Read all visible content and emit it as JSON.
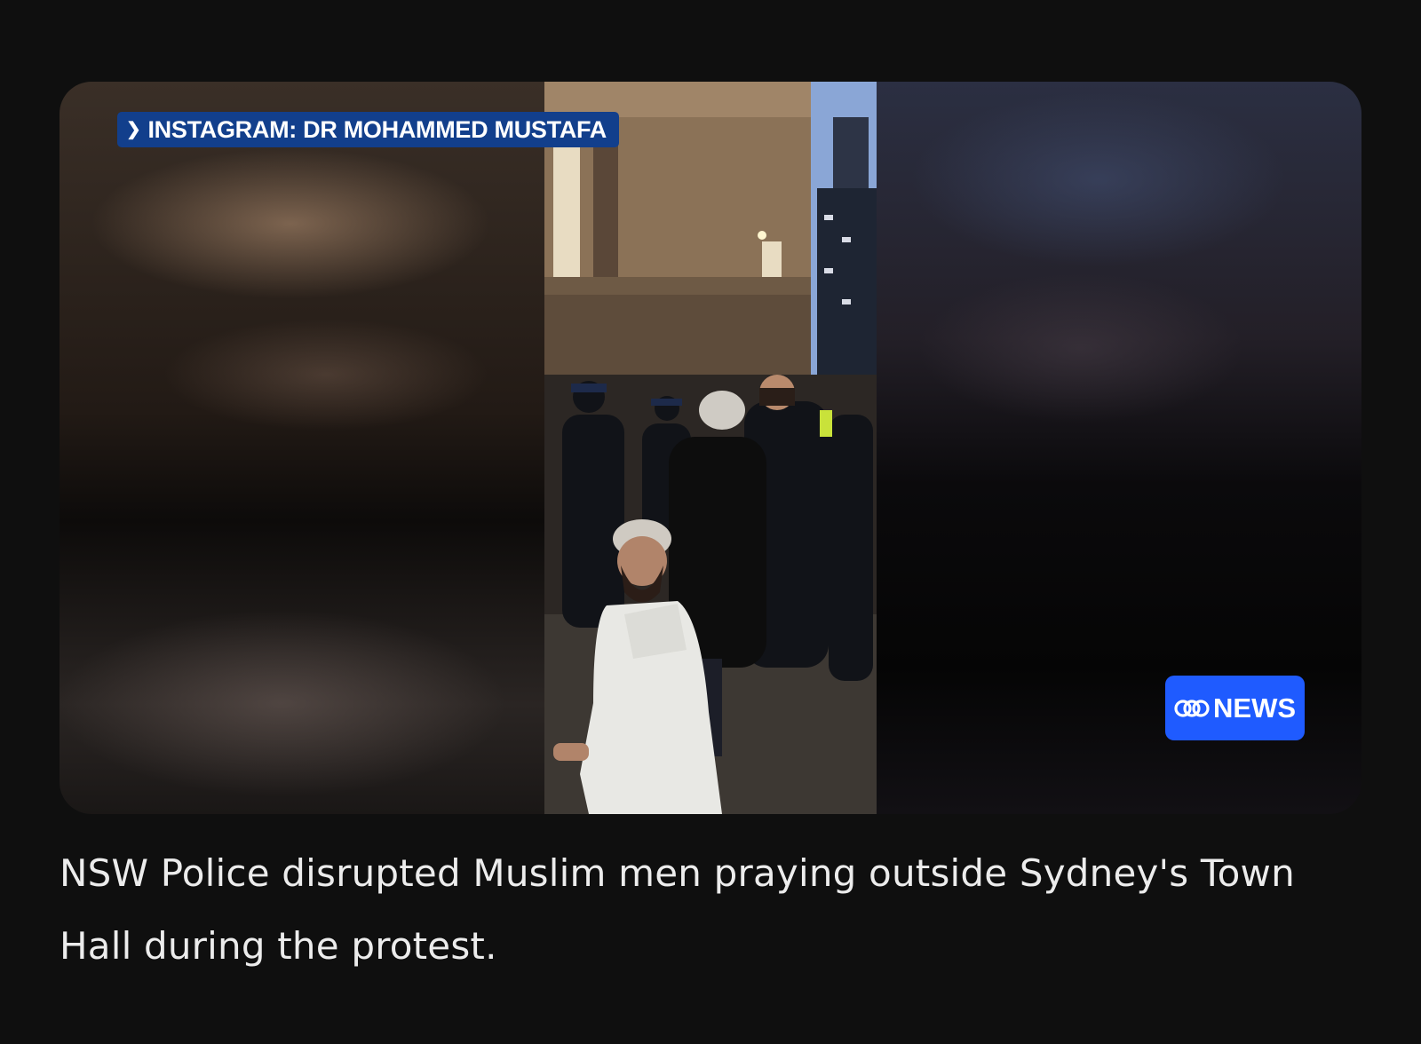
{
  "video": {
    "source_tag": "INSTAGRAM: DR MOHAMMED MUSTAFA",
    "source_icon": "play-chevron-icon",
    "brand_badge": "NEWS",
    "brand_icon": "abc-logo-icon",
    "scene": "police-prayer-photo"
  },
  "caption": "NSW Police disrupted Muslim men praying outside Sydney's Town Hall during the protest.",
  "colors": {
    "background": "#0f0f0f",
    "source_tag": "#123f8c",
    "brand_badge": "#1f5bff",
    "caption_text": "#ececec"
  }
}
